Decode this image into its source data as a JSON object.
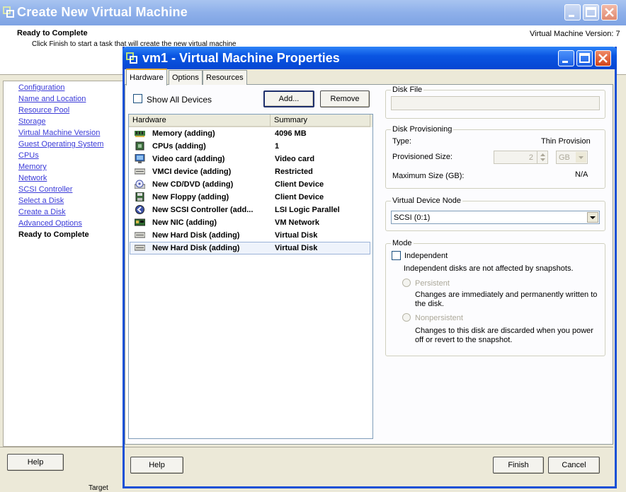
{
  "outer": {
    "title": "Create New Virtual Machine",
    "heading": "Ready to Complete",
    "subheading": "Click Finish to start a task that will create the new virtual machine",
    "version": "Virtual Machine Version: 7",
    "nav": [
      "Configuration",
      "Name and Location",
      "Resource Pool",
      "Storage",
      "Virtual Machine Version",
      "Guest Operating System",
      "CPUs",
      "Memory",
      "Network",
      "SCSI Controller",
      "Select a Disk",
      "Create a Disk",
      "Advanced Options"
    ],
    "nav_current": "Ready to Complete",
    "help_label": "Help",
    "target_label": "Target"
  },
  "dialog": {
    "title": "vm1 - Virtual Machine Properties",
    "tabs": [
      "Hardware",
      "Options",
      "Resources"
    ],
    "show_all_devices": "Show All Devices",
    "add_label": "Add...",
    "remove_label": "Remove",
    "columns": [
      "Hardware",
      "Summary"
    ],
    "rows": [
      {
        "name": "Memory (adding)",
        "summary": "4096 MB",
        "icon": "memory-icon"
      },
      {
        "name": "CPUs (adding)",
        "summary": "1",
        "icon": "cpu-icon"
      },
      {
        "name": "Video card  (adding)",
        "summary": "Video card",
        "icon": "monitor-icon"
      },
      {
        "name": "VMCI device (adding)",
        "summary": "Restricted",
        "icon": "device-icon"
      },
      {
        "name": "New CD/DVD (adding)",
        "summary": "Client Device",
        "icon": "cd-icon"
      },
      {
        "name": "New Floppy (adding)",
        "summary": "Client Device",
        "icon": "floppy-icon"
      },
      {
        "name": "New SCSI Controller (add...",
        "summary": "LSI Logic Parallel",
        "icon": "scsi-icon"
      },
      {
        "name": "New NIC (adding)",
        "summary": "VM Network",
        "icon": "nic-icon"
      },
      {
        "name": "New Hard Disk (adding)",
        "summary": "Virtual Disk",
        "icon": "disk-icon"
      },
      {
        "name": "New Hard Disk (adding)",
        "summary": "Virtual Disk",
        "icon": "disk-icon"
      }
    ],
    "disk_file": {
      "group": "Disk File",
      "value": ""
    },
    "provisioning": {
      "group": "Disk Provisioning",
      "type_label": "Type:",
      "type_value": "Thin Provision",
      "prov_size_label": "Provisioned Size:",
      "prov_size_value": "2",
      "unit": "GB",
      "max_size_label": "Maximum Size (GB):",
      "max_size_value": "N/A"
    },
    "vdn": {
      "group": "Virtual Device Node",
      "selected": "SCSI (0:1)"
    },
    "mode": {
      "group": "Mode",
      "independent": "Independent",
      "independent_desc": "Independent disks are not affected by snapshots.",
      "persistent": "Persistent",
      "persistent_desc1": "Changes are immediately and permanently written to",
      "persistent_desc2": "the disk.",
      "nonpersistent": "Nonpersistent",
      "nonpersistent_desc1": "Changes to this disk are discarded when you power",
      "nonpersistent_desc2": "off or revert to the snapshot."
    },
    "help_label": "Help",
    "finish_label": "Finish",
    "cancel_label": "Cancel"
  },
  "colors": {
    "dialog_title": "#0a55e2",
    "outer_title": "#8eb0ea",
    "link": "#3a3ad8",
    "face": "#ece9d8"
  }
}
